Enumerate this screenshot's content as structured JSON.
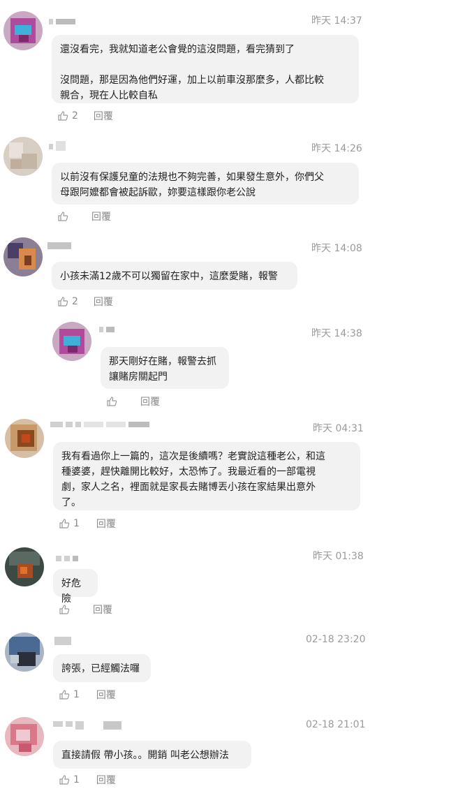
{
  "comments": [
    {
      "time": "昨天 14:37",
      "text": "還沒看完，我就知道老公會覺的這沒問題，看完猜到了\n\n沒問題，那是因為他們好運，加上以前車沒那麼多，人都比較\n親合，現在人比較自私",
      "likes": "2",
      "reply": "回覆"
    },
    {
      "time": "昨天 14:26",
      "text": "以前沒有保護兒童的法規也不夠完善，如果發生意外，你們父\n母跟阿嬤都會被起訴歐，妳要這樣跟你老公說",
      "likes": "",
      "reply": "回覆"
    },
    {
      "time": "昨天 14:08",
      "text": "小孩未滿12歲不可以獨留在家中，這麼愛賭，報警",
      "likes": "2",
      "reply": "回覆"
    },
    {
      "time": "昨天 14:38",
      "text": "那天剛好在賭，報警去抓\n讓賭房關起門",
      "likes": "",
      "reply": "回覆"
    },
    {
      "time": "昨天 04:31",
      "text": "我有看過你上一篇的，這次是後續嗎？老實說這種老公，和這\n種婆婆，趕快離開比較好，太恐怖了。我最近看的一部電視\n劇，家人之名，裡面就是家長去賭博丟小孩在家結果出意外\n了。",
      "likes": "1",
      "reply": "回覆"
    },
    {
      "time": "昨天 01:38",
      "text": "好危險",
      "likes": "",
      "reply": "回覆"
    },
    {
      "time": "02-18 23:20",
      "text": "誇張，已經觸法囉",
      "likes": "1",
      "reply": "回覆"
    },
    {
      "time": "02-18 21:01",
      "text": "直接請假 帶小孩。。開銷 叫老公想辦法",
      "likes": "1",
      "reply": "回覆"
    }
  ],
  "icons": {
    "like": "thumbs-up-icon"
  },
  "colors": {
    "bubble": "#f2f2f2",
    "meta_text": "#8a8a8a",
    "time_text": "#9a9a9a"
  }
}
